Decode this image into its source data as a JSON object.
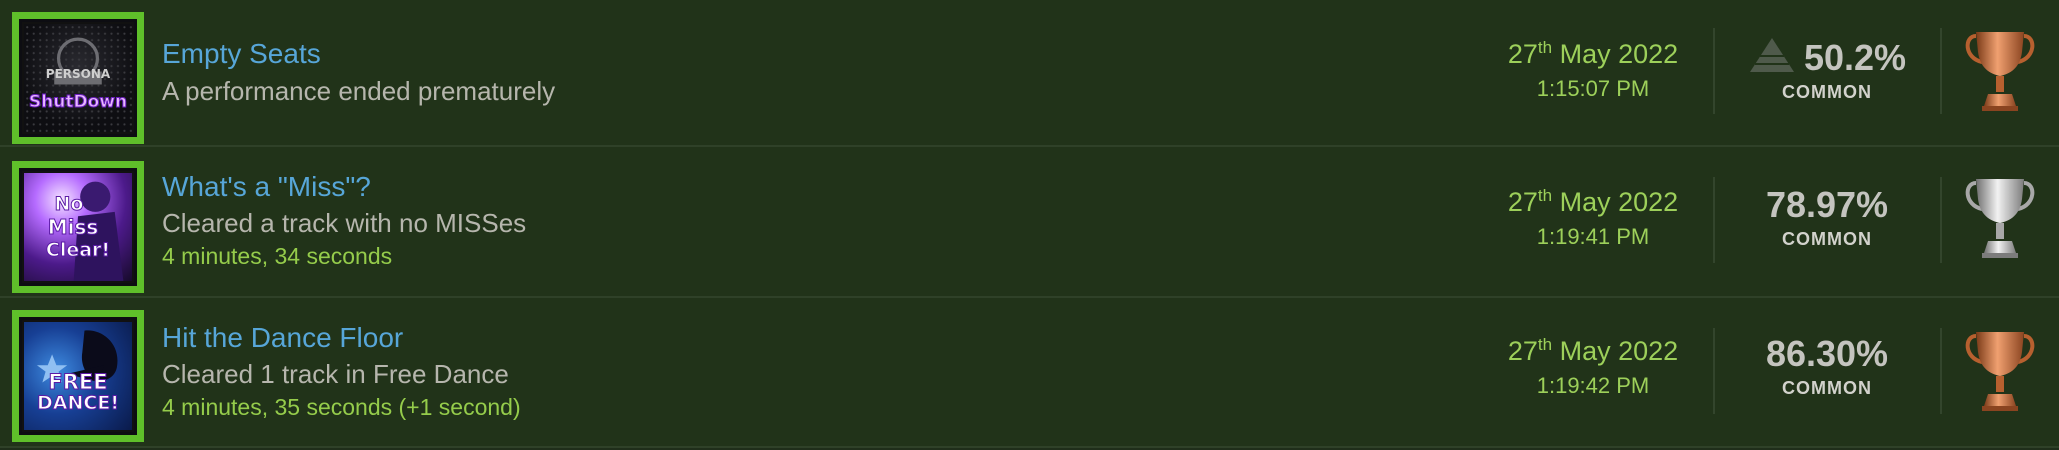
{
  "achievements": [
    {
      "icon": "persona-shutdown-icon",
      "icon_text": [
        "PERSONA",
        "ShutDown"
      ],
      "title": "Empty Seats",
      "description": "A performance ended prematurely",
      "time_note": "",
      "date_day": "27",
      "date_suffix": "th",
      "date_rest": " May 2022",
      "time": "1:15:07 PM",
      "percent": "50.2%",
      "rarity": "COMMON",
      "trophy": "bronze"
    },
    {
      "icon": "no-miss-clear-icon",
      "icon_text": [
        "No",
        "Miss",
        "Clear!"
      ],
      "title": "What's a \"Miss\"?",
      "description": "Cleared a track with no MISSes",
      "time_note": "4 minutes, 34 seconds",
      "date_day": "27",
      "date_suffix": "th",
      "date_rest": " May 2022",
      "time": "1:19:41 PM",
      "percent": "78.97%",
      "rarity": "COMMON",
      "trophy": "silver"
    },
    {
      "icon": "free-dance-icon",
      "icon_text": [
        "FREE",
        "DANCE!"
      ],
      "title": "Hit the Dance Floor",
      "description": "Cleared 1 track in Free Dance",
      "time_note": "4 minutes, 35 seconds (+1 second)",
      "date_day": "27",
      "date_suffix": "th",
      "date_rest": " May 2022",
      "time": "1:19:42 PM",
      "percent": "86.30%",
      "rarity": "COMMON",
      "trophy": "bronze"
    }
  ],
  "colors": {
    "background": "#213319",
    "thumb_border": "#5fbf2a",
    "title": "#57a6d8",
    "description": "#b6b6ad",
    "date": "#9dd05a",
    "bronze": "#c8703a",
    "silver": "#c9c9c9"
  }
}
